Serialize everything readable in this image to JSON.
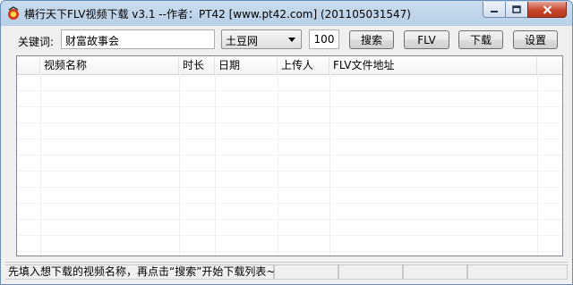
{
  "window": {
    "title": "横行天下FLV视频下载 v3.1 --作者：PT42 [www.pt42.com]    (201105031547)"
  },
  "search": {
    "keyword_label": "关键词:",
    "keyword_value": "财富故事会",
    "site_selected": "土豆网",
    "count_value": "100"
  },
  "toolbar": {
    "search_label": "搜索",
    "flv_label": "FLV",
    "download_label": "下载",
    "settings_label": "设置"
  },
  "list": {
    "columns": [
      "视频名称",
      "时长",
      "日期",
      "上传人",
      "FLV文件地址"
    ]
  },
  "status": {
    "message": "先填入想下载的视频名称，再点击“搜索”开始下载列表~"
  },
  "icons": {
    "app": "app-logo-icon",
    "minimize": "minimize-icon",
    "maximize": "maximize-icon",
    "close": "close-icon",
    "dropdown": "chevron-down-icon"
  }
}
